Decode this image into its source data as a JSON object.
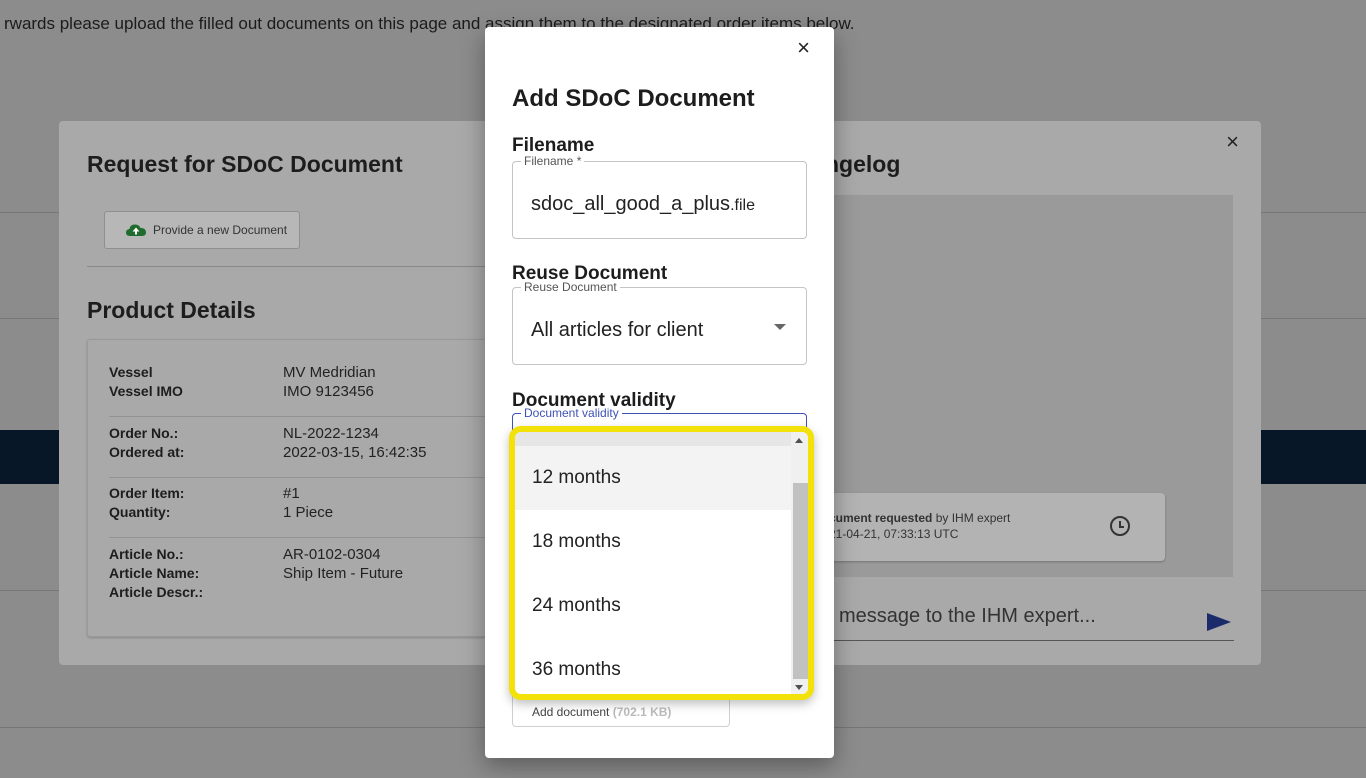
{
  "background": {
    "instruction_text": "rwards please upload the filled out documents on this page and assign them to the designated order items below."
  },
  "request_modal": {
    "close_glyph": "×",
    "title": "Request for SDoC Document",
    "changelog_title": "ngelog",
    "provide_button_label": "Provide a new Document",
    "product_details_title": "Product Details",
    "rows": [
      {
        "label1": "Vessel",
        "value1": "MV Medridian",
        "label2": "Vessel IMO",
        "value2": "IMO 9123456"
      },
      {
        "label1": "Order No.:",
        "value1": "NL-2022-1234",
        "label2": "Ordered at:",
        "value2": "2022-03-15, 16:42:35"
      },
      {
        "label1": "Order Item:",
        "value1": "#1",
        "label2": "Quantity:",
        "value2": "1 Piece"
      },
      {
        "label1": "Article No.:",
        "value1": "AR-0102-0304",
        "label2": "Article Name:",
        "value2": "Ship Item - Future",
        "label3": "Article Descr.:"
      }
    ],
    "changelog_entry": {
      "bold_text": "cument requested",
      "text": " by IHM expert",
      "timestamp": "21-04-21, 07:33:13 UTC"
    },
    "message_placeholder": "message to the IHM expert..."
  },
  "add_modal": {
    "close_glyph": "×",
    "title": "Add SDoC Document",
    "filename_section": "Filename",
    "filename_legend": "Filename *",
    "filename_value": "sdoc_all_good_a_plus",
    "filename_ext": ".file",
    "reuse_section": "Reuse Document",
    "reuse_legend": "Reuse Document",
    "reuse_value": "All articles for client",
    "validity_section": "Document validity",
    "validity_legend": "Document validity",
    "add_button_label": "Add document ",
    "add_button_size": "(702.1 KB)"
  },
  "dropdown": {
    "options": [
      "12 months",
      "18 months",
      "24 months",
      "36 months"
    ],
    "hovered_index": 0,
    "highlight_color": "#f2e20a"
  }
}
